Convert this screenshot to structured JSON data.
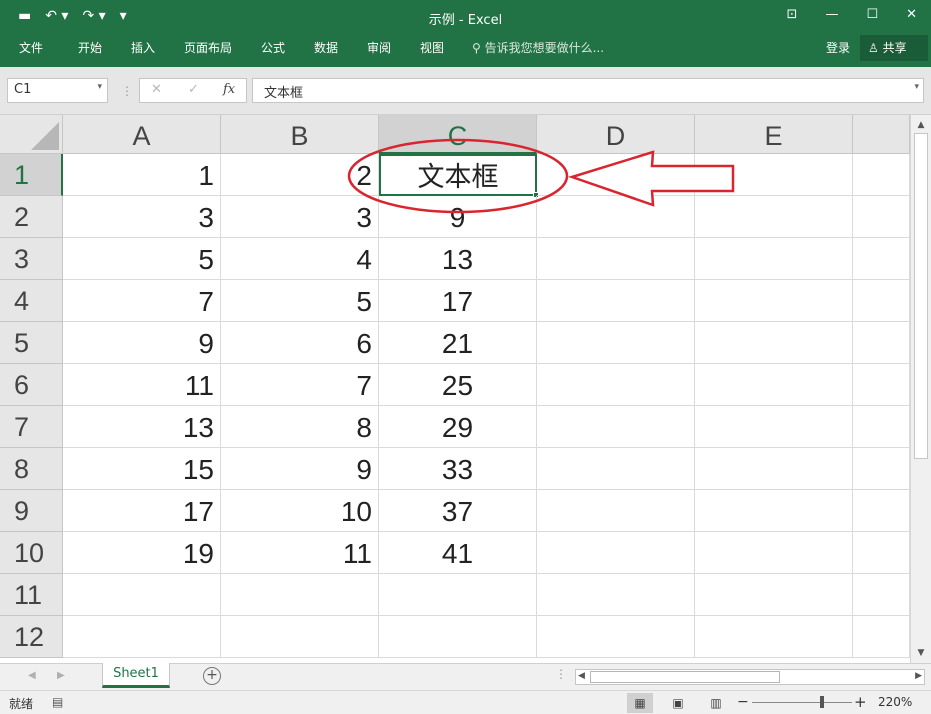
{
  "window": {
    "title": "示例 - Excel",
    "qat": {
      "save_icon": "▬",
      "undo_icon": "↶ ▾",
      "redo_icon": "↷ ▾",
      "customize_icon": "▾"
    },
    "controls": {
      "ribbon_display": "⊡",
      "minimize": "—",
      "maximize": "☐",
      "close": "✕"
    }
  },
  "ribbon": {
    "tabs": [
      "文件",
      "开始",
      "插入",
      "页面布局",
      "公式",
      "数据",
      "审阅",
      "视图"
    ],
    "tell_me": "告诉我您想要做什么...",
    "login": "登录",
    "share": "共享"
  },
  "formula_bar": {
    "name_box": "C1",
    "name_box_dropdown": "▾",
    "separator": "⋮",
    "cancel": "✕",
    "enter": "✓",
    "fx": "fx",
    "content": "文本框",
    "expand": "▾"
  },
  "columns": [
    "A",
    "B",
    "C",
    "D",
    "E"
  ],
  "selected_column": "C",
  "rows": [
    {
      "num": "1",
      "A": "1",
      "B": "2",
      "C": "文本框"
    },
    {
      "num": "2",
      "A": "3",
      "B": "3",
      "C": "9"
    },
    {
      "num": "3",
      "A": "5",
      "B": "4",
      "C": "13"
    },
    {
      "num": "4",
      "A": "7",
      "B": "5",
      "C": "17"
    },
    {
      "num": "5",
      "A": "9",
      "B": "6",
      "C": "21"
    },
    {
      "num": "6",
      "A": "11",
      "B": "7",
      "C": "25"
    },
    {
      "num": "7",
      "A": "13",
      "B": "8",
      "C": "29"
    },
    {
      "num": "8",
      "A": "15",
      "B": "9",
      "C": "33"
    },
    {
      "num": "9",
      "A": "17",
      "B": "10",
      "C": "37"
    },
    {
      "num": "10",
      "A": "19",
      "B": "11",
      "C": "41"
    },
    {
      "num": "11",
      "A": "",
      "B": "",
      "C": ""
    },
    {
      "num": "12",
      "A": "",
      "B": "",
      "C": ""
    }
  ],
  "annotation": {
    "ellipse_color": "#d9252f",
    "arrow_color": "#d9252f"
  },
  "sheets": {
    "tabs": [
      "Sheet1"
    ],
    "active": "Sheet1",
    "add": "+",
    "nav_prev": "◀",
    "nav_next": "▶",
    "more": "⋮"
  },
  "status": {
    "ready": "就绪",
    "macro_icon": "▤",
    "view_normal": "▦",
    "view_layout": "▣",
    "view_pagebreak": "▥",
    "zoom_minus": "−",
    "zoom_plus": "+",
    "zoom": "220%",
    "zoom_value": 220
  },
  "accent": "#217346"
}
